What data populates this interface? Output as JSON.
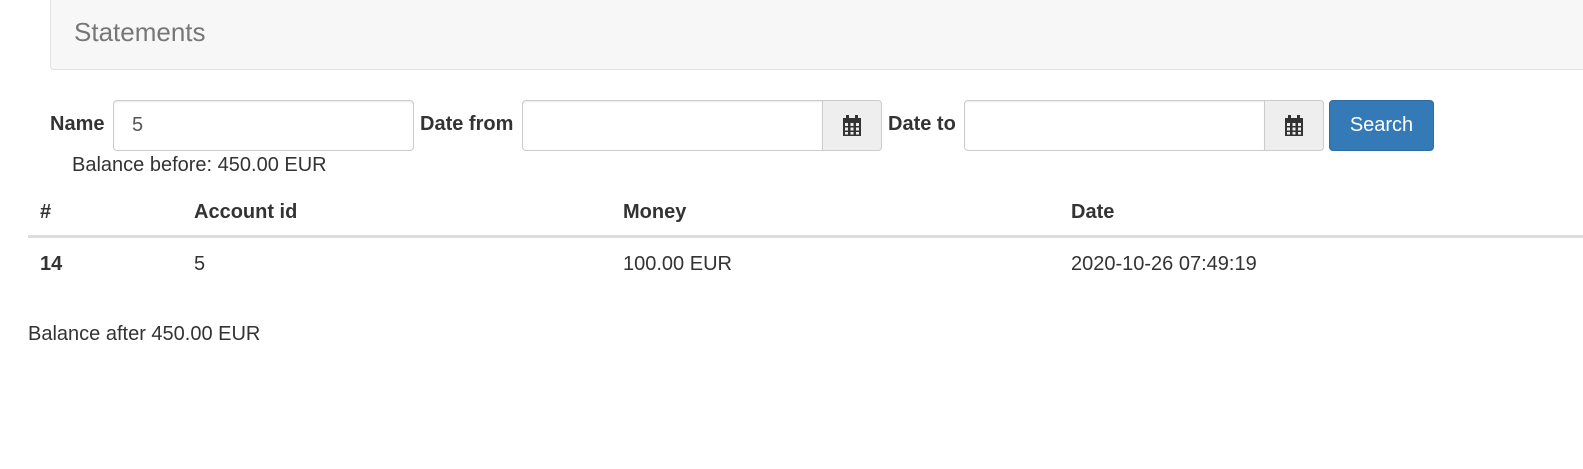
{
  "header": {
    "title": "Statements"
  },
  "filters": {
    "name_label": "Name",
    "name_value": "5",
    "date_from_label": "Date from",
    "date_from_value": "",
    "date_to_label": "Date to",
    "date_to_value": "",
    "search_label": "Search",
    "calendar_icon": "calendar-icon"
  },
  "balance_before": "Balance before: 450.00 EUR",
  "table": {
    "columns": [
      "#",
      "Account id",
      "Money",
      "Date"
    ],
    "rows": [
      {
        "id": "14",
        "account_id": "5",
        "money": "100.00 EUR",
        "date": "2020-10-26 07:49:19"
      }
    ]
  },
  "balance_after": "Balance after 450.00 EUR",
  "colors": {
    "primary": "#337ab7",
    "header_bg": "#f7f7f7",
    "addon_bg": "#eeeeee"
  }
}
